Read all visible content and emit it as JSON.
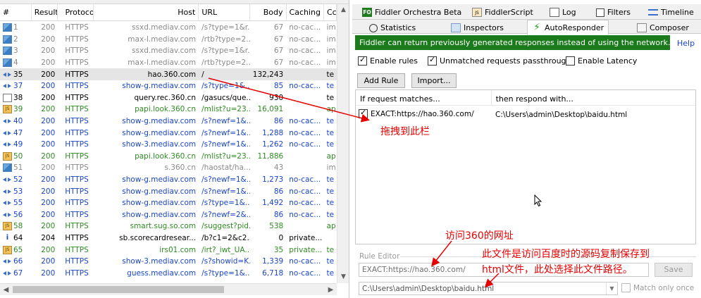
{
  "grid": {
    "headers": {
      "num": "#",
      "result": "Result",
      "protocol": "Protocol",
      "host": "Host",
      "url": "URL",
      "body": "Body",
      "caching": "Caching",
      "content_type": "Cc"
    },
    "rows": [
      {
        "num": "1",
        "result": "200",
        "protocol": "HTTPS",
        "host": "ssxd.mediav.com",
        "url": "/s?type=1&r...",
        "body": "67",
        "caching": "no-cac...",
        "ct": "im",
        "icon": "image-icon",
        "tone": "grey"
      },
      {
        "num": "2",
        "result": "200",
        "protocol": "HTTPS",
        "host": "max-l.mediav.com",
        "url": "/rtb?type=2...",
        "body": "67",
        "caching": "no-cac...",
        "ct": "im",
        "icon": "image-icon",
        "tone": "grey"
      },
      {
        "num": "3",
        "result": "200",
        "protocol": "HTTPS",
        "host": "ssxd.mediav.com",
        "url": "/s?type=1&r...",
        "body": "67",
        "caching": "no-cac...",
        "ct": "im",
        "icon": "image-icon",
        "tone": "grey"
      },
      {
        "num": "4",
        "result": "200",
        "protocol": "HTTPS",
        "host": "max-l.mediav.com",
        "url": "/rtb?type=2...",
        "body": "67",
        "caching": "no-cac...",
        "ct": "im",
        "icon": "image-icon",
        "tone": "grey"
      },
      {
        "num": "35",
        "result": "200",
        "protocol": "HTTPS",
        "host": "hao.360.com",
        "url": "/",
        "body": "132,243",
        "caching": "",
        "ct": "te",
        "icon": "arrows-icon",
        "tone": "black",
        "selected": true
      },
      {
        "num": "37",
        "result": "200",
        "protocol": "HTTPS",
        "host": "show-g.mediav.com",
        "url": "/s?type=1&...",
        "body": "85",
        "caching": "no-cac...",
        "ct": "te",
        "icon": "arrows-icon",
        "tone": "blue"
      },
      {
        "num": "38",
        "result": "200",
        "protocol": "HTTPS",
        "host": "query.rec.360.cn",
        "url": "/gasucs/que...",
        "body": "930",
        "caching": "",
        "ct": "te",
        "icon": "document-icon",
        "tone": "black"
      },
      {
        "num": "39",
        "result": "200",
        "protocol": "HTTPS",
        "host": "papi.look.360.cn",
        "url": "/mlist?u=23...",
        "body": "16,091",
        "caching": "",
        "ct": "ap",
        "icon": "script-icon",
        "tone": "green"
      },
      {
        "num": "40",
        "result": "200",
        "protocol": "HTTPS",
        "host": "show-g.mediav.com",
        "url": "/s?newf=1&...",
        "body": "86",
        "caching": "no-cac...",
        "ct": "te",
        "icon": "arrows-icon",
        "tone": "blue"
      },
      {
        "num": "47",
        "result": "200",
        "protocol": "HTTPS",
        "host": "show-g.mediav.com",
        "url": "/s?newf=1&...",
        "body": "1,288",
        "caching": "no-cac...",
        "ct": "te",
        "icon": "arrows-icon",
        "tone": "blue"
      },
      {
        "num": "49",
        "result": "200",
        "protocol": "HTTPS",
        "host": "show-3.mediav.com",
        "url": "/s?newf=1&...",
        "body": "1,262",
        "caching": "no-cac...",
        "ct": "te",
        "icon": "arrows-icon",
        "tone": "blue"
      },
      {
        "num": "50",
        "result": "200",
        "protocol": "HTTPS",
        "host": "papi.look.360.cn",
        "url": "/mlist?u=23...",
        "body": "11,886",
        "caching": "",
        "ct": "ap",
        "icon": "script-icon",
        "tone": "green"
      },
      {
        "num": "51",
        "result": "200",
        "protocol": "HTTPS",
        "host": "s.360.cn",
        "url": "/haostat/ha...",
        "body": "43",
        "caching": "",
        "ct": "im",
        "icon": "image-icon",
        "tone": "grey"
      },
      {
        "num": "52",
        "result": "200",
        "protocol": "HTTPS",
        "host": "show-g.mediav.com",
        "url": "/s?newf=1&...",
        "body": "1,273",
        "caching": "no-cac...",
        "ct": "te",
        "icon": "arrows-icon",
        "tone": "blue"
      },
      {
        "num": "53",
        "result": "200",
        "protocol": "HTTPS",
        "host": "show-g.mediav.com",
        "url": "/s?newf=1&...",
        "body": "86",
        "caching": "no-cac...",
        "ct": "te",
        "icon": "arrows-icon",
        "tone": "blue"
      },
      {
        "num": "55",
        "result": "200",
        "protocol": "HTTPS",
        "host": "show-g.mediav.com",
        "url": "/s?type=1&...",
        "body": "1,492",
        "caching": "no-cac...",
        "ct": "te",
        "icon": "arrows-icon",
        "tone": "blue"
      },
      {
        "num": "56",
        "result": "200",
        "protocol": "HTTPS",
        "host": "show-g.mediav.com",
        "url": "/s?newf=2&...",
        "body": "86",
        "caching": "no-cac...",
        "ct": "te",
        "icon": "arrows-icon",
        "tone": "blue"
      },
      {
        "num": "58",
        "result": "200",
        "protocol": "HTTPS",
        "host": "smart.sug.so.com",
        "url": "/suggest?pid...",
        "body": "538",
        "caching": "",
        "ct": "ap",
        "icon": "script-icon",
        "tone": "green"
      },
      {
        "num": "64",
        "result": "204",
        "protocol": "HTTPS",
        "host": "sb.scorecardresear...",
        "url": "/b?c1=2&c2...",
        "body": "0",
        "caching": "private...",
        "ct": "",
        "icon": "info-icon",
        "tone": "black"
      },
      {
        "num": "65",
        "result": "200",
        "protocol": "HTTPS",
        "host": "irs01.com",
        "url": "/irt?_iwt_UA...",
        "body": "35",
        "caching": "private...",
        "ct": "te",
        "icon": "script-icon",
        "tone": "green"
      },
      {
        "num": "66",
        "result": "200",
        "protocol": "HTTPS",
        "host": "show-3.mediav.com",
        "url": "/s?showid=K...",
        "body": "1,339",
        "caching": "no-cac...",
        "ct": "te",
        "icon": "arrows-icon",
        "tone": "blue"
      },
      {
        "num": "67",
        "result": "200",
        "protocol": "HTTPS",
        "host": "guess.mediav.com",
        "url": "/s?type=1&...",
        "body": "6,718",
        "caching": "no-cac...",
        "ct": "te",
        "icon": "arrows-icon",
        "tone": "blue"
      }
    ]
  },
  "tabs_row1": [
    {
      "label": "Fiddler Orchestra Beta",
      "icon": "fo-icon"
    },
    {
      "label": "FiddlerScript",
      "icon": "script-icon"
    },
    {
      "label": "Log",
      "icon": "log-icon"
    },
    {
      "label": "Filters",
      "icon": "filters-icon"
    },
    {
      "label": "Timeline",
      "icon": "timeline-icon"
    }
  ],
  "tabs_row2": [
    {
      "label": "Statistics",
      "icon": "stopwatch-icon"
    },
    {
      "label": "Inspectors",
      "icon": "inspectors-icon"
    },
    {
      "label": "AutoResponder",
      "icon": "lightning-icon",
      "active": true
    },
    {
      "label": "Composer",
      "icon": "composer-icon"
    }
  ],
  "autoresponder": {
    "banner": "Fiddler can return previously generated responses instead of using the network.",
    "help": "Help",
    "enable_rules": "Enable rules",
    "unmatched": "Unmatched requests passthrough",
    "latency": "Enable Latency",
    "add_rule": "Add Rule",
    "import": "Import...",
    "col_if": "If request matches...",
    "col_then": "then respond with...",
    "rule_match": "EXACT:https://hao.360.com/",
    "rule_response": "C:\\Users\\admin\\Desktop\\baidu.html",
    "editor_label": "Rule Editor",
    "editor_match": "EXACT:https://hao.360.com/",
    "editor_response": "C:\\Users\\admin\\Desktop\\baidu.html",
    "save": "Save",
    "match_only_once": "Match only once"
  },
  "annotations": {
    "drag_here": "拖拽到此栏",
    "visit_url": "访问360的网址",
    "file_note_1": "此文件是访问百度时的源码复制保存到",
    "file_note_2": "html文件，此处选择此文件路径。"
  },
  "colors": {
    "annotation": "#e60000",
    "banner": "#1b7a1b",
    "grey_row": "#8a8a8a",
    "blue_row": "#1a44c8",
    "green_row": "#2e8b22"
  }
}
